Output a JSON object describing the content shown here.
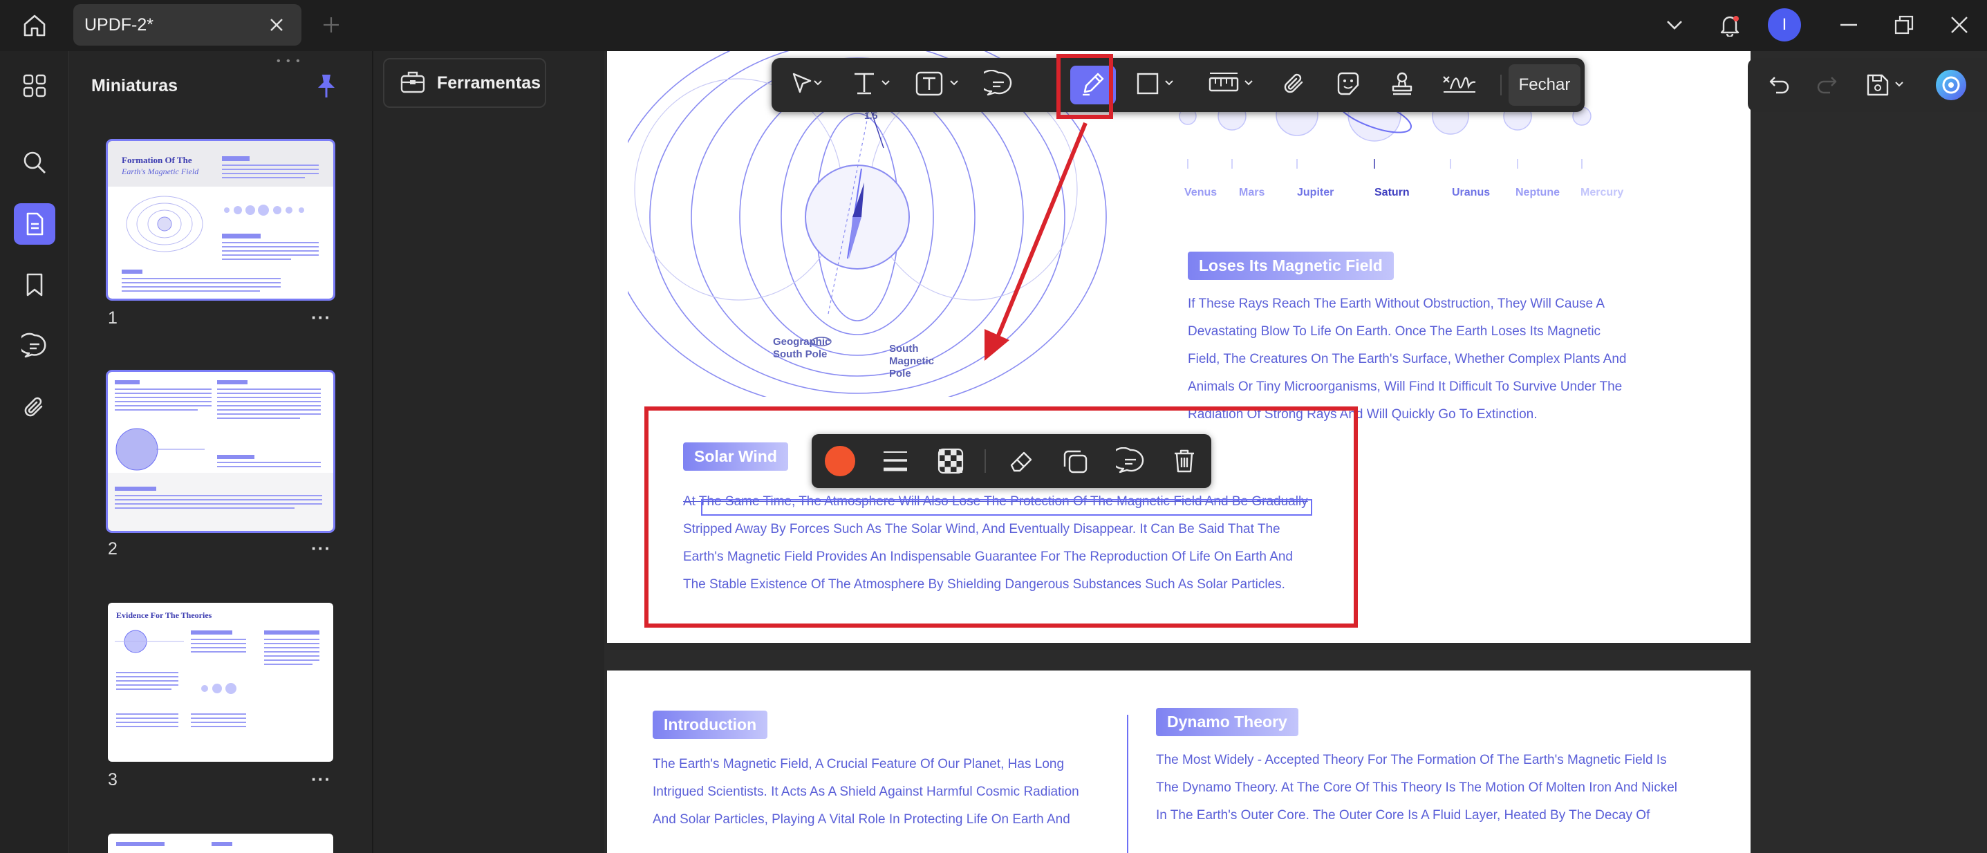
{
  "tab": {
    "title": "UPDF-2*"
  },
  "user": {
    "initial": "I"
  },
  "thumbnails": {
    "title": "Miniaturas",
    "pages": [
      {
        "number": "1",
        "heading": "Formation Of The",
        "heading2": "Earth's Magnetic Field"
      },
      {
        "number": "2"
      },
      {
        "number": "3",
        "heading": "Evidence For The Theories"
      }
    ],
    "more": "···"
  },
  "tools_panel": {
    "label": "Ferramentas"
  },
  "toolbar": {
    "close_label": "Fechar",
    "measure_label": "1.5"
  },
  "page1": {
    "planets": [
      "Venus",
      "Mars",
      "Jupiter",
      "Saturn",
      "Uranus",
      "Neptune",
      "Mercury"
    ],
    "figure_labels": {
      "geo_south": "Geographic South Pole",
      "mag_south": "South Magnetic Pole"
    },
    "loses_heading": "Loses Its Magnetic Field",
    "loses_lines": [
      "If These Rays Reach The Earth Without Obstruction, They Will Cause A",
      "Devastating Blow To Life On Earth. Once The Earth Loses Its Magnetic",
      "Field, The Creatures On The Earth's Surface, Whether Complex Plants And",
      "Animals Or Tiny Microorganisms, Will Find It Difficult To Survive Under The",
      "Radiation Of Strong Rays And Will Quickly Go To Extinction."
    ],
    "solar_heading": "Solar Wind",
    "solar_lines": [
      "At The Same Time, The Atmosphere Will Also Lose The Protection Of The Magnetic Field And Be Gradually",
      "Stripped Away By Forces Such As The Solar Wind, And Eventually Disappear. It Can Be Said That The",
      "Earth's Magnetic Field Provides An Indispensable Guarantee For The Reproduction Of Life On Earth And",
      "The Stable Existence Of The Atmosphere By Shielding Dangerous Substances Such As Solar Particles."
    ]
  },
  "page2": {
    "intro_heading": "Introduction",
    "intro_lines": [
      "The Earth's Magnetic Field, A Crucial Feature Of Our Planet, Has Long",
      "Intrigued Scientists. It Acts As A Shield Against Harmful Cosmic Radiation",
      "And Solar Particles, Playing A Vital Role In Protecting Life On Earth And"
    ],
    "dynamo_heading": "Dynamo Theory",
    "dynamo_lines": [
      "The Most Widely - Accepted Theory For The Formation Of The Earth's Magnetic Field Is",
      "The Dynamo Theory. At The Core Of This Theory Is The Motion Of Molten Iron And Nickel",
      "In The Earth's Outer Core. The Outer Core Is A Fluid Layer, Heated By The Decay Of"
    ]
  },
  "colors": {
    "accent": "#6d70f5",
    "annotation_red": "#d9232b",
    "doc_text": "#5a5fd8",
    "pen_color": "#f2542d"
  }
}
